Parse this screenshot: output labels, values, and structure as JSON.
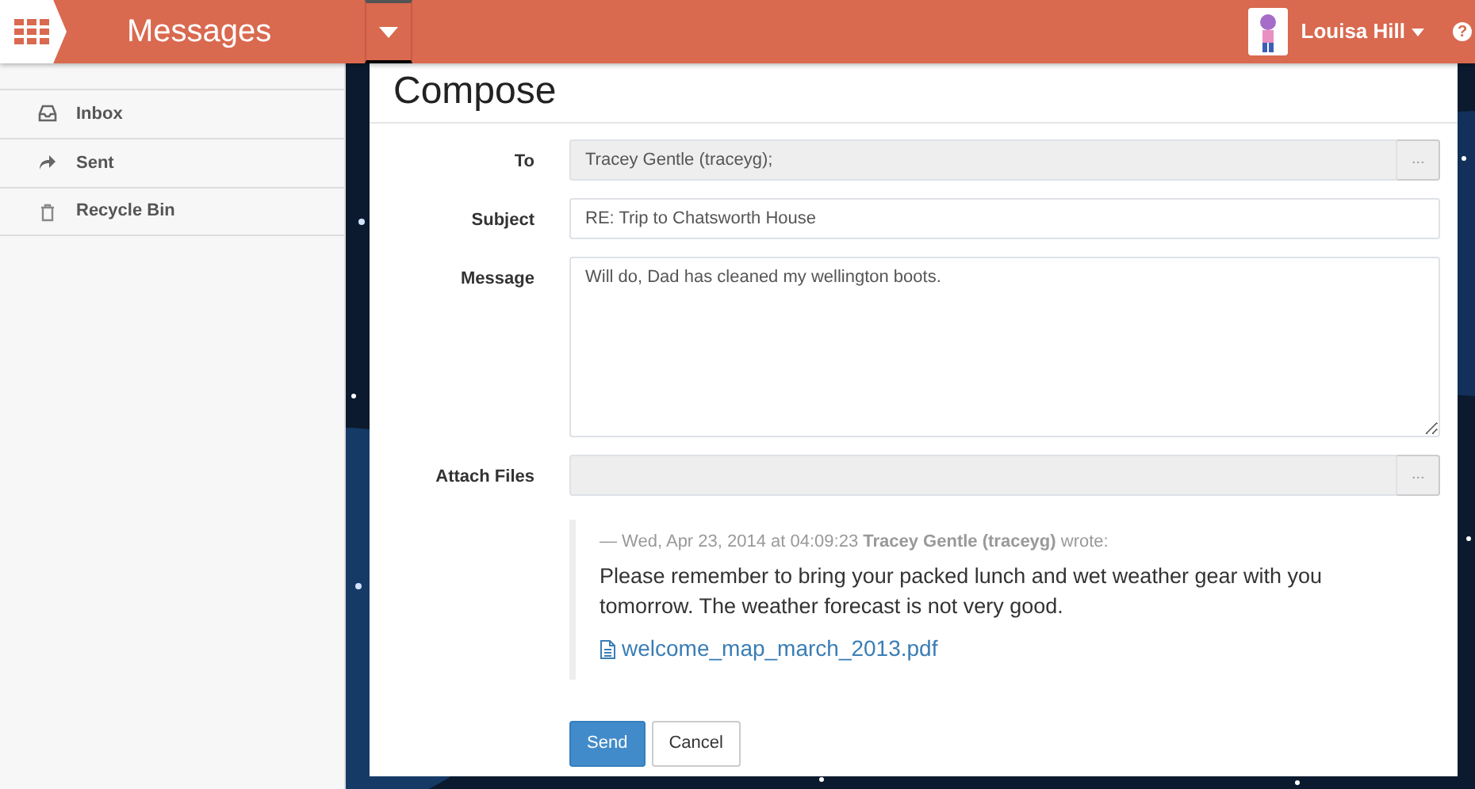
{
  "header": {
    "app_title": "Messages",
    "user_name": "Louisa Hill",
    "help_icon": "?"
  },
  "sidebar": {
    "items": [
      {
        "label": "Inbox",
        "kind": "inbox"
      },
      {
        "label": "Sent",
        "kind": "sent"
      },
      {
        "label": "Recycle Bin",
        "kind": "bin"
      }
    ]
  },
  "compose": {
    "title": "Compose",
    "fields": [
      {
        "label": "To",
        "kind": "picker",
        "value": "Tracey Gentle (traceyg);",
        "disabled": true,
        "button": "..."
      },
      {
        "label": "Subject",
        "kind": "text",
        "value": "RE: Trip to Chatsworth House",
        "disabled": false
      },
      {
        "label": "Message",
        "kind": "textarea",
        "value": "Will do, Dad has cleaned my wellington boots.",
        "disabled": false
      },
      {
        "label": "Attach Files",
        "kind": "picker",
        "disabled": true,
        "button": "..."
      }
    ],
    "quote": {
      "meta": "— Wed, Apr 23, 2014 at 04:09:23 **Tracey Gentle (traceyg)** wrote:",
      "body": "Please remember to bring your packed lunch and wet weather gear with you tomorrow. The weather forecast is not very good.",
      "attachment": "welcome_map_march_2013.pdf"
    },
    "buttons": [
      {
        "label": "Send",
        "kind": "primary"
      },
      {
        "label": "Cancel",
        "kind": "secondary"
      }
    ]
  }
}
